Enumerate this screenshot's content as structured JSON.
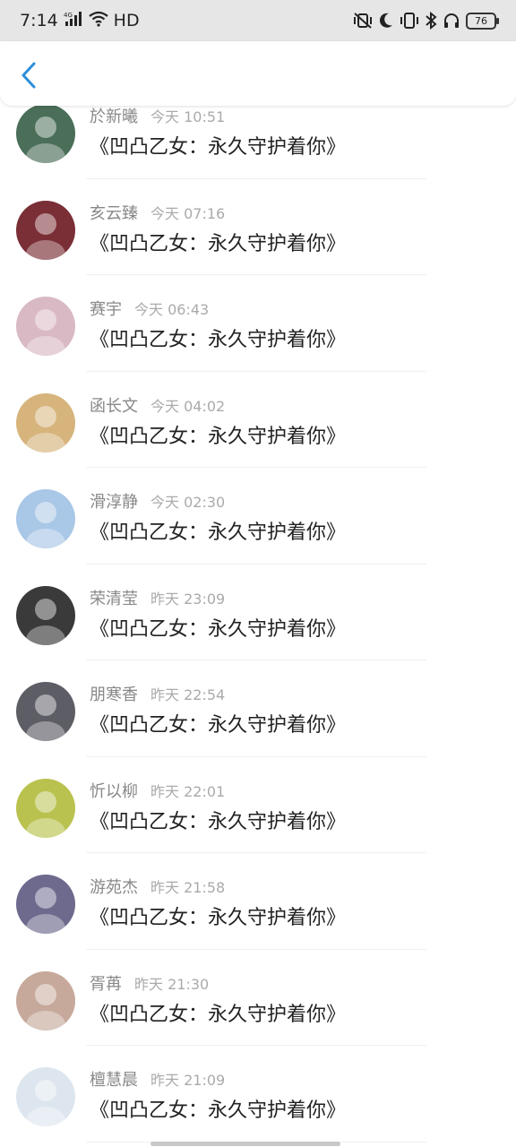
{
  "status_bar": {
    "time": "7:14",
    "network": "HD",
    "battery": "76"
  },
  "header": {
    "back_icon": "chevron-left-icon",
    "accent_color": "#2d8fd8"
  },
  "messages": [
    {
      "name": "於新曦",
      "time": "今天 10:51",
      "text": "《凹凸乙女：永久守护着你》",
      "avatar_color": "#4a6e58"
    },
    {
      "name": "亥云臻",
      "time": "今天 07:16",
      "text": "《凹凸乙女：永久守护着你》",
      "avatar_color": "#7a2e36"
    },
    {
      "name": "赛宇",
      "time": "今天 06:43",
      "text": "《凹凸乙女：永久守护着你》",
      "avatar_color": "#d9b9c4"
    },
    {
      "name": "函长文",
      "time": "今天 04:02",
      "text": "《凹凸乙女：永久守护着你》",
      "avatar_color": "#d6b47c"
    },
    {
      "name": "滑淳静",
      "time": "今天 02:30",
      "text": "《凹凸乙女：永久守护着你》",
      "avatar_color": "#a9c7e6"
    },
    {
      "name": "荣清莹",
      "time": "昨天 23:09",
      "text": "《凹凸乙女：永久守护着你》",
      "avatar_color": "#3a3a3a"
    },
    {
      "name": "朋寒香",
      "time": "昨天 22:54",
      "text": "《凹凸乙女：永久守护着你》",
      "avatar_color": "#5d5d66"
    },
    {
      "name": "忻以柳",
      "time": "昨天 22:01",
      "text": "《凹凸乙女：永久守护着你》",
      "avatar_color": "#b9c24e"
    },
    {
      "name": "游苑杰",
      "time": "昨天 21:58",
      "text": "《凹凸乙女：永久守护着你》",
      "avatar_color": "#6d6a8e"
    },
    {
      "name": "胥苒",
      "time": "昨天 21:30",
      "text": "《凹凸乙女：永久守护着你》",
      "avatar_color": "#c7a99c"
    },
    {
      "name": "檀慧晨",
      "time": "昨天 21:09",
      "text": "《凹凸乙女：永久守护着你》",
      "avatar_color": "#dde6ee"
    }
  ]
}
